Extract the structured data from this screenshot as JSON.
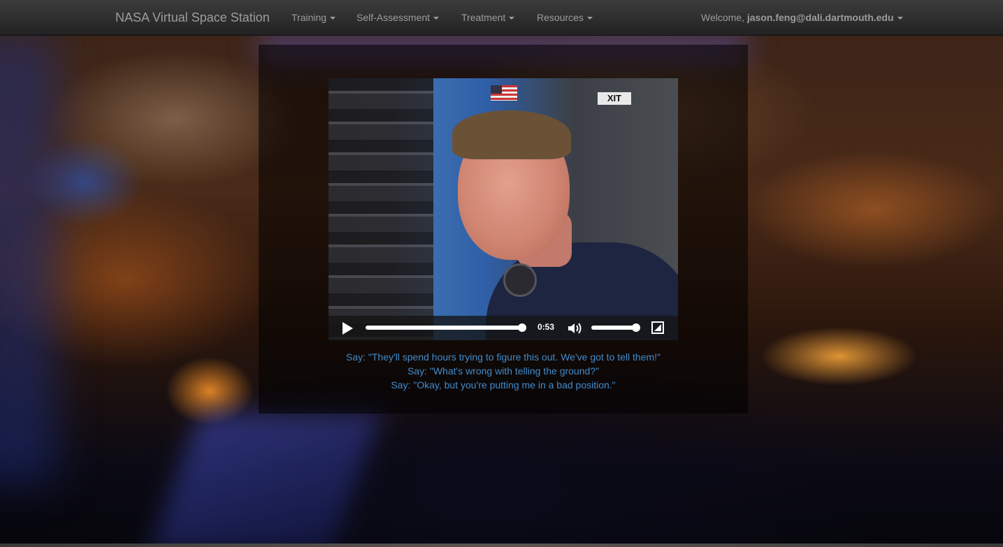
{
  "navbar": {
    "brand": "NASA Virtual Space Station",
    "items": [
      {
        "label": "Training"
      },
      {
        "label": "Self-Assessment"
      },
      {
        "label": "Treatment"
      },
      {
        "label": "Resources"
      }
    ],
    "welcome_prefix": "Welcome, ",
    "user_email": "jason.feng@dali.dartmouth.edu"
  },
  "video": {
    "time": "0:53",
    "progress": 1.0,
    "volume": 0.85,
    "icons": {
      "play": "play-icon",
      "volume": "volume-icon",
      "fullscreen": "fullscreen-icon"
    },
    "scene_sign": "XIT"
  },
  "options": [
    "Say: \"They'll spend hours trying to figure this out. We've got to tell them!\"",
    "Say: \"What's wrong with telling the ground?\"",
    "Say: \"Okay, but you're putting me in a bad position.\""
  ],
  "colors": {
    "link": "#428bca",
    "navbar_text": "#9d9d9d"
  }
}
